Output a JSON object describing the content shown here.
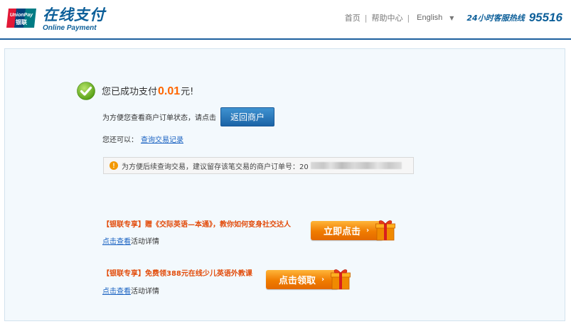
{
  "header": {
    "brand_cn": "在线支付",
    "brand_en": "Online Payment",
    "logo_text_top": "UnionPay",
    "logo_text_bottom": "银联",
    "nav": {
      "home": "首页",
      "help": "帮助中心",
      "language": "English",
      "hotline_label": "24小时客服热线",
      "hotline_number": "95516"
    }
  },
  "result": {
    "prefix": "您已成功支付",
    "amount": "0.01",
    "suffix": "元!",
    "return_prompt": "为方便您查看商户订单状态，请点击",
    "return_button": "返回商户",
    "also_prompt": "您还可以：",
    "query_link": "查询交易记录",
    "notice": "为方便后续查询交易，建议留存该笔交易的商户订单号：20"
  },
  "promos": [
    {
      "title": "【银联专享】赠《交际英语—本通》，教你如何变身社交达人",
      "detail_link": "点击查看",
      "detail_suffix": "活动详情",
      "button": "立即点击"
    },
    {
      "title": "【银联专享】免费领388元在线少儿英语外教课",
      "detail_link": "点击查看",
      "detail_suffix": "活动详情",
      "button": "点击领取"
    }
  ],
  "colors": {
    "brand_blue": "#0d5f99",
    "amount_orange": "#ff6600",
    "promo_red": "#e24c0b",
    "link_blue": "#1b63c2"
  }
}
